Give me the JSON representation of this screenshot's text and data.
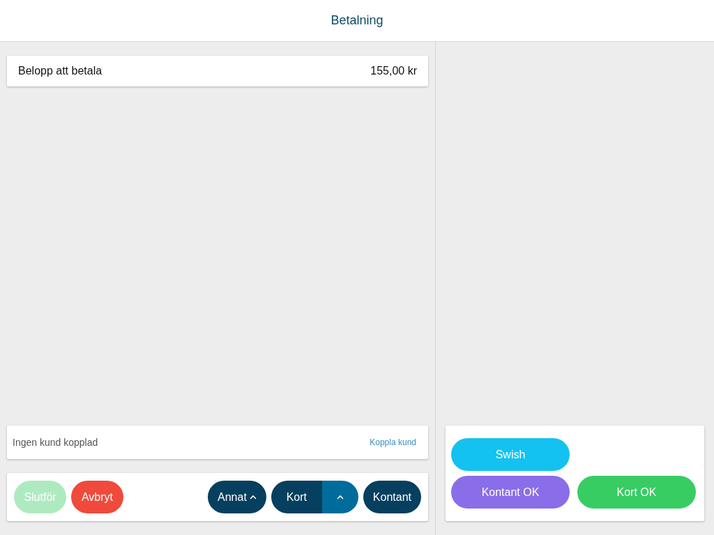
{
  "header": {
    "title": "Betalning"
  },
  "amount": {
    "label": "Belopp att betala",
    "value": "155,00 kr"
  },
  "customer": {
    "status": "Ingen kund kopplad",
    "link": "Koppla kund"
  },
  "actions": [
    {
      "label": "Slutför",
      "kind": "finish",
      "disabled": true
    },
    {
      "label": "Avbryt",
      "kind": "cancel",
      "disabled": false
    }
  ],
  "payment_buttons": [
    {
      "label": "Annat",
      "kind": "dropdown"
    },
    {
      "label": "Kort",
      "kind": "split"
    },
    {
      "label": "Kontant",
      "kind": "plain"
    }
  ],
  "quick_payments": [
    {
      "label": "Swish",
      "color": "#13c2f0"
    },
    {
      "label": "Kontant OK",
      "color": "#8a6de9"
    },
    {
      "label": "Kort OK",
      "color": "#37cd63"
    }
  ]
}
